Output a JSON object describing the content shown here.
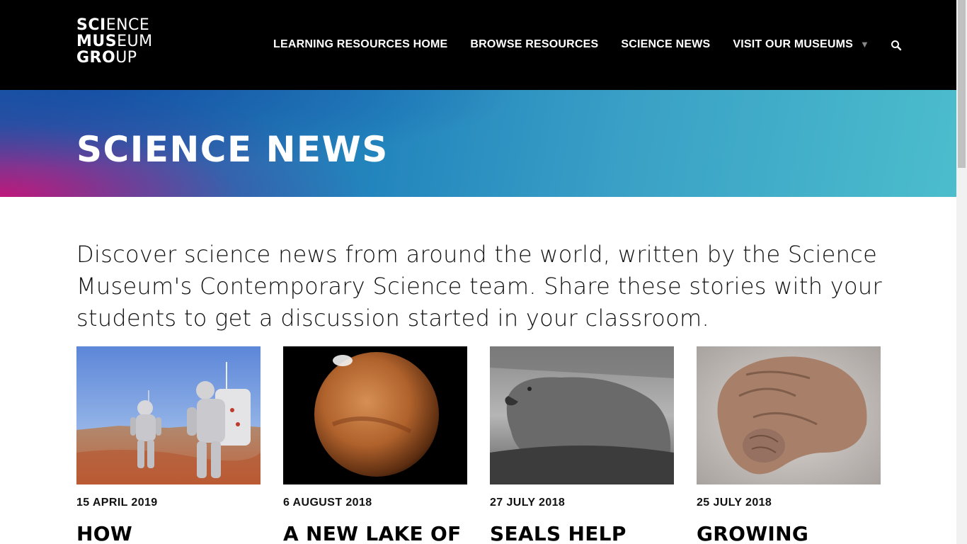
{
  "header": {
    "logo": {
      "line1_bold": "SCI",
      "line1_thin": "ENCE",
      "line2_bold": "MUS",
      "line2_thin": "EUM",
      "line3_bold": "GRO",
      "line3_thin": "UP"
    },
    "nav": [
      {
        "label": "LEARNING RESOURCES HOME"
      },
      {
        "label": "BROWSE RESOURCES"
      },
      {
        "label": "SCIENCE NEWS"
      },
      {
        "label": "VISIT OUR MUSEUMS"
      }
    ],
    "dropdown_icon": "caret-down-icon",
    "search_icon": "search-icon"
  },
  "hero": {
    "title": "SCIENCE NEWS"
  },
  "intro": {
    "text": "Discover science news from around the world, written by the Science Museum's Contemporary Science team. Share these stories with your students to get a discussion started in your classroom."
  },
  "cards": [
    {
      "date": "15 APRIL 2019",
      "title": "HOW SCIENTISTS",
      "image": "astronauts-desert"
    },
    {
      "date": "6 AUGUST 2018",
      "title": "A NEW LAKE OF",
      "image": "planet-mars"
    },
    {
      "date": "27 JULY 2018",
      "title": "SEALS HELP",
      "image": "elephant-seal"
    },
    {
      "date": "25 JULY 2018",
      "title": "GROWING",
      "image": "brain-specimen"
    }
  ],
  "colors": {
    "header_bg": "#000000",
    "hero_start": "#c8147a",
    "hero_mid": "#2385bd",
    "hero_end": "#4bbdcc"
  }
}
